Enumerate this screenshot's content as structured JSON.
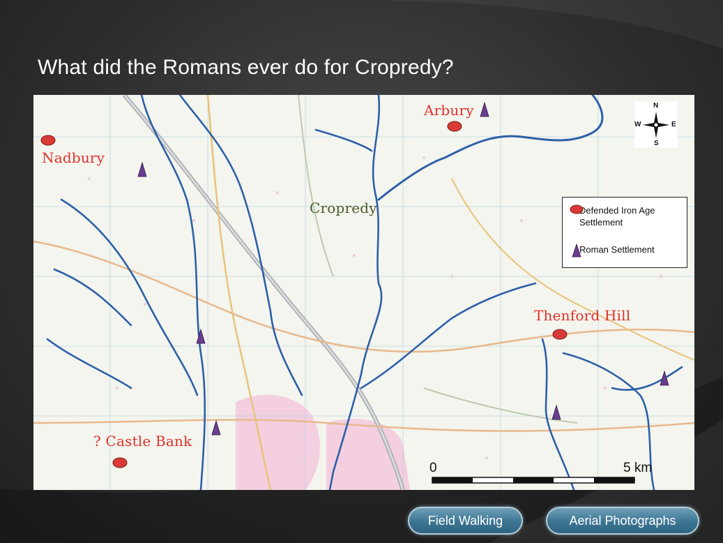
{
  "slide": {
    "title": "What did the Romans ever do for Cropredy?"
  },
  "map": {
    "place_labels": {
      "nadbury": "Nadbury",
      "arbury": "Arbury",
      "cropredy": "Cropredy",
      "thenford_hill": "Thenford Hill",
      "castle_bank": "? Castle Bank"
    },
    "legend": {
      "iron_age": "Defended Iron Age Settlement",
      "roman": "Roman Settlement"
    },
    "compass": {
      "n": "N",
      "e": "E",
      "s": "S",
      "w": "W"
    },
    "scale": {
      "start": "0",
      "end": "5 km"
    },
    "colors": {
      "river": "#2e5fa8",
      "iron_age_marker": "#d93a35",
      "roman_marker": "#6a3d8f",
      "label_red": "#e0302a",
      "town": "#f4cfe0"
    }
  },
  "buttons": {
    "field_walking": "Field Walking",
    "aerial_photographs": "Aerial Photographs"
  }
}
